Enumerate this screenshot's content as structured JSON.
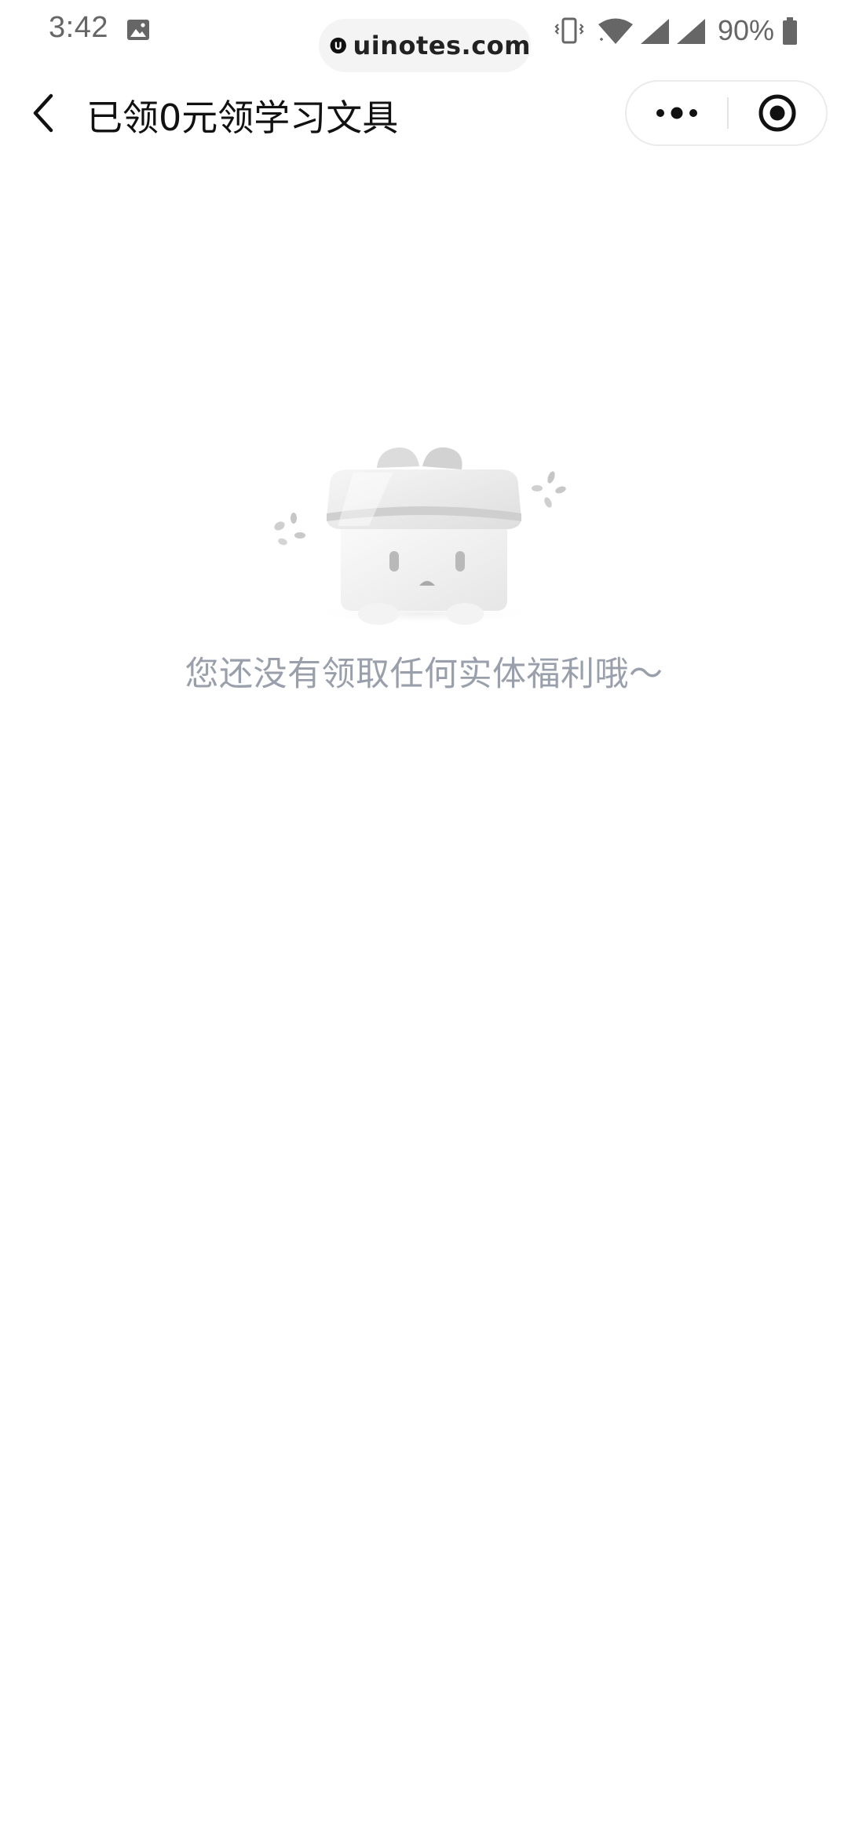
{
  "status_bar": {
    "time": "3:42",
    "battery_percent": "90%",
    "watermark_text": "uinotes.com",
    "icons": [
      "gallery-icon",
      "vibrate-icon",
      "wifi-icon",
      "signal-icon",
      "signal-icon",
      "battery-icon"
    ]
  },
  "title_bar": {
    "title": "已领0元领学习文具",
    "back_icon": "chevron-left-icon",
    "more_icon": "more-dots-icon",
    "close_icon": "target-circle-icon"
  },
  "empty_state": {
    "illustration": "gift-box-illustration",
    "message": "您还没有领取任何实体福利哦～"
  },
  "colors": {
    "background": "#ffffff",
    "title_text": "#111111",
    "empty_text": "#9aa0ab",
    "status_text": "#666666"
  }
}
